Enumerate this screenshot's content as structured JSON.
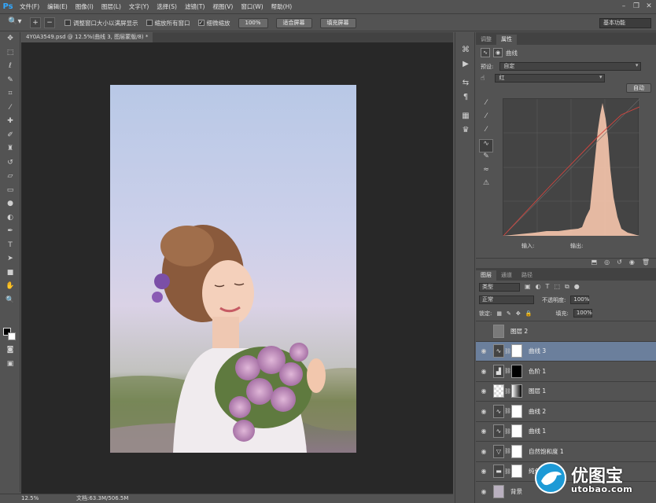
{
  "app": {
    "logo": "Ps"
  },
  "menu": [
    "文件(F)",
    "编辑(E)",
    "图像(I)",
    "图层(L)",
    "文字(Y)",
    "选择(S)",
    "滤镜(T)",
    "视图(V)",
    "窗口(W)",
    "帮助(H)"
  ],
  "options": {
    "resize_windows": "调整窗口大小以满屏显示",
    "zoom_all": "缩放所有窗口",
    "scrubby_zoom": "细微缩放",
    "btn_100": "100%",
    "btn_fit": "适合屏幕",
    "btn_fill": "填充屏幕",
    "workspace": "基本功能"
  },
  "document": {
    "tab": "4Y0A3549.psd @ 12.5%(曲线 3, 图层蒙版/8) *"
  },
  "status": {
    "zoom": "12.5%",
    "doc": "文档:63.3M/506.5M"
  },
  "properties": {
    "tabs": [
      "调整",
      "属性"
    ],
    "title": "曲线",
    "preset_label": "预设:",
    "preset_value": "自定",
    "channel_value": "红",
    "auto_label": "自动",
    "input_label": "输入:",
    "output_label": "输出:"
  },
  "layers_panel": {
    "tabs": [
      "图层",
      "通道",
      "路径"
    ],
    "filter_type": "类型",
    "blend_mode": "正常",
    "opacity_label": "不透明度:",
    "opacity_value": "100%",
    "lock_label": "锁定:",
    "fill_label": "填充:",
    "fill_value": "100%",
    "layers": [
      {
        "name": "图层 2",
        "visible": false
      },
      {
        "name": "曲线 3",
        "visible": true,
        "selected": true
      },
      {
        "name": "色阶 1",
        "visible": true
      },
      {
        "name": "图层 1",
        "visible": true
      },
      {
        "name": "曲线 2",
        "visible": true
      },
      {
        "name": "曲线 1",
        "visible": true
      },
      {
        "name": "自然饱和度 1",
        "visible": true
      },
      {
        "name": "纯色",
        "visible": true
      },
      {
        "name": "背景",
        "visible": true
      }
    ]
  },
  "watermark": {
    "title": "优图宝",
    "url": "utobao.com"
  },
  "colors": {
    "histogram": "#f7c6ad",
    "selection": "#6b7f9c",
    "accent": "#31a8ff"
  }
}
